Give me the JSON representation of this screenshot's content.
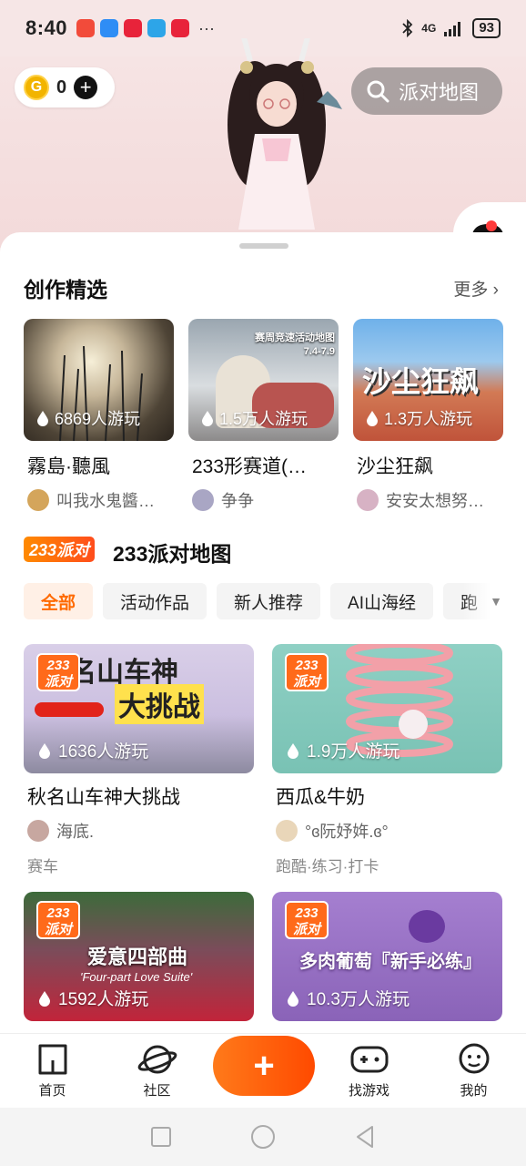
{
  "status_bar": {
    "time": "8:40",
    "network": "4G",
    "battery": "93"
  },
  "header": {
    "coin_count": "0",
    "search_label": "派对地图"
  },
  "featured": {
    "title": "创作精选",
    "more_label": "更多",
    "items": [
      {
        "plays": "6869人游玩",
        "name": "霧島·聽風",
        "author": "叫我水鬼醬…"
      },
      {
        "plays": "1.5万人游玩",
        "name": "233形赛道(…",
        "author": "争争",
        "thumb_caption": "赛周竞速活动地图",
        "thumb_dates": "7.4-7.9"
      },
      {
        "plays": "1.3万人游玩",
        "name": "沙尘狂飙",
        "author": "安安太想努…",
        "thumb_caption": "沙尘狂飙"
      }
    ]
  },
  "party": {
    "tag": "233派对",
    "title": "233派对地图",
    "tabs": [
      "全部",
      "活动作品",
      "新人推荐",
      "AI山海经",
      "跑"
    ],
    "badge_top": "233",
    "badge_bottom": "派对",
    "items": [
      {
        "plays": "1636人游玩",
        "name": "秋名山车神大挑战",
        "author": "海底.",
        "tags": "赛车",
        "thumb_caption_1": "名山车神",
        "thumb_caption_2": "大挑战"
      },
      {
        "plays": "1.9万人游玩",
        "name": "西瓜&牛奶",
        "author": "°ɞ阮妤姩.ɞ°",
        "tags": "跑酷·练习·打卡"
      },
      {
        "plays": "1592人游玩",
        "thumb_caption_1": "爱意四部曲",
        "thumb_caption_2": "'Four-part Love Suite'"
      },
      {
        "plays": "10.3万人游玩",
        "thumb_caption_1": "多肉葡萄『新手必练』"
      }
    ]
  },
  "bottom_nav": {
    "items": [
      {
        "label": "首页"
      },
      {
        "label": "社区"
      },
      {
        "label": "找游戏"
      },
      {
        "label": "我的"
      }
    ],
    "fab_label": "+"
  },
  "colors": {
    "accent": "#ff6a00",
    "background": "#f6e6e6"
  }
}
